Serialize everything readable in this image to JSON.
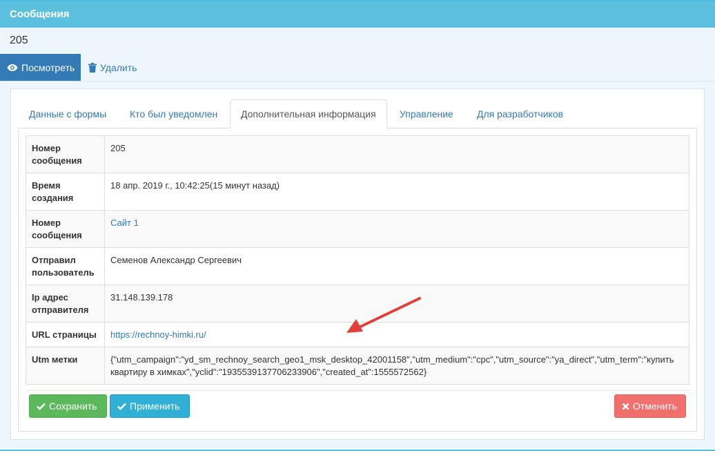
{
  "header": {
    "title": "Сообщения"
  },
  "record": {
    "id": "205"
  },
  "toolbar": {
    "view_label": "Посмотреть",
    "delete_label": "Удалить"
  },
  "tabs": [
    {
      "label": "Данные с формы"
    },
    {
      "label": "Кто был уведомлен"
    },
    {
      "label": "Дополнительная информация"
    },
    {
      "label": "Управление"
    },
    {
      "label": "Для разработчиков"
    }
  ],
  "info": {
    "rows": [
      {
        "label": "Номер сообщения",
        "value": "205"
      },
      {
        "label": "Время создания",
        "value": "18 апр. 2019 г., 10:42:25(15 минут назад)"
      },
      {
        "label": "Номер сообщения",
        "value": "Сайт 1"
      },
      {
        "label": "Отправил пользователь",
        "value": "Семенов Александр Сергеевич"
      },
      {
        "label": "Ip адрес отправителя",
        "value": "31.148.139.178"
      },
      {
        "label": "URL страницы",
        "value": "https://rechnoy-himki.ru/"
      },
      {
        "label": "Utm метки",
        "value": "{\"utm_campaign\":\"yd_sm_rechnoy_search_geo1_msk_desktop_42001158\",\"utm_medium\":\"cpc\",\"utm_source\":\"ya_direct\",\"utm_term\":\"купить квартиру в химках\",\"yclid\":\"1935539137706233906\",\"created_at\":1555572562}"
      }
    ]
  },
  "buttons": {
    "save_label": "Сохранить",
    "apply_label": "Применить",
    "cancel_label": "Отменить"
  },
  "colors": {
    "header": "#5bc0de",
    "primary": "#337ab7",
    "success": "#5cb85c",
    "info": "#31b0d5",
    "danger": "#f0706d",
    "annotation_arrow": "#e0403a"
  },
  "icons": {
    "view": "eye-icon",
    "delete": "trash-icon",
    "save": "check-icon",
    "apply": "check-icon",
    "cancel": "close-icon"
  }
}
